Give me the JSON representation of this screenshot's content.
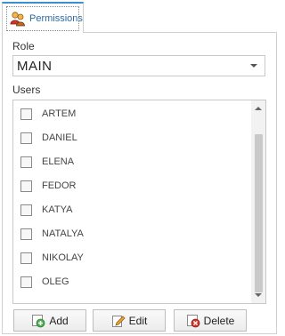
{
  "tab": {
    "label": "Permissions",
    "icon": "users-group-icon"
  },
  "role": {
    "label": "Role",
    "value": "MAIN"
  },
  "users": {
    "label": "Users",
    "items": [
      {
        "name": "ARTEM",
        "checked": false
      },
      {
        "name": "DANIEL",
        "checked": false
      },
      {
        "name": "ELENA",
        "checked": false
      },
      {
        "name": "FEDOR",
        "checked": false
      },
      {
        "name": "KATYA",
        "checked": false
      },
      {
        "name": "NATALYA",
        "checked": false
      },
      {
        "name": "NIKOLAY",
        "checked": false
      },
      {
        "name": "OLEG",
        "checked": false
      }
    ]
  },
  "buttons": {
    "add_label": "Add",
    "edit_label": "Edit",
    "delete_label": "Delete"
  },
  "colors": {
    "tab_accent": "#3a8fd0",
    "tab_text": "#2c6aa0",
    "add_icon": "#4caf50",
    "edit_icon": "#e8a33d",
    "delete_icon": "#d9342b"
  }
}
